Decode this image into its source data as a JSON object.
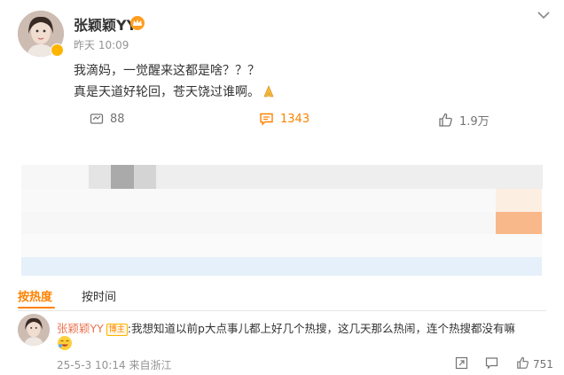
{
  "post": {
    "author": "张颖颖YY",
    "time": "昨天 10:09",
    "line1": "我滴妈，一觉醒来这都是啥？？？",
    "line2": "真是天道好轮回，苍天饶过谁啊。",
    "repost_count": "88",
    "comment_count": "1343",
    "like_count": "1.9万"
  },
  "tabs": {
    "hot": "按热度",
    "time": "按时间"
  },
  "comment": {
    "author": "张颖颖YY",
    "tag": "博主",
    "text": ":我想知道以前p大点事儿都上好几个热搜，这几天那么热闹，连个热搜都没有嘛",
    "date": "25-5-3 10:14",
    "location": "来自浙江",
    "like_count": "751"
  },
  "colors": {
    "accent": "#ff8200",
    "name_link": "#eb7350",
    "muted": "#939393"
  },
  "icons": [
    "collapse-chevron-icon",
    "repost-icon",
    "comment-icon",
    "like-icon",
    "share-icon",
    "reply-icon",
    "pray-emoji-icon",
    "laugh-emoji-icon",
    "crown-badge-icon",
    "verified-badge-icon"
  ]
}
